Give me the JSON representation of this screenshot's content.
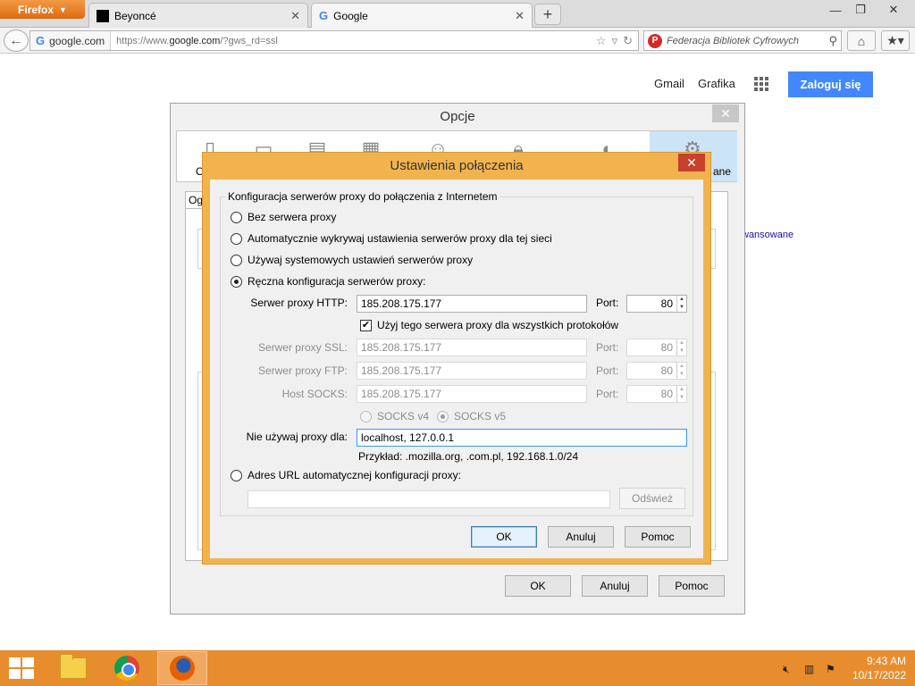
{
  "browser": {
    "menu_button": "Firefox",
    "tabs": [
      {
        "label": "Beyoncé"
      },
      {
        "label": "Google"
      }
    ],
    "identity": "google.com",
    "url_prefix": "https://www.",
    "url_domain": "google.com",
    "url_suffix": "/?gws_rd=ssl",
    "search_placeholder": "Federacja Bibliotek Cyfrowych"
  },
  "google": {
    "gmail": "Gmail",
    "images": "Grafika",
    "signin": "Zaloguj się",
    "partial_link": "wansowane"
  },
  "options_dialog": {
    "title": "Opcje",
    "partial_tab_o": "O",
    "partial_tab_ane": "ane",
    "partial_subtab": "Og",
    "ok": "OK",
    "cancel": "Anuluj",
    "help": "Pomoc"
  },
  "connection_dialog": {
    "title": "Ustawienia połączenia",
    "legend": "Konfiguracja serwerów proxy do połączenia z Internetem",
    "radio_no_proxy": "Bez serwera proxy",
    "radio_auto_detect": "Automatycznie wykrywaj ustawienia serwerów proxy dla tej sieci",
    "radio_system": "Używaj systemowych ustawień serwerów proxy",
    "radio_manual": "Ręczna konfiguracja serwerów proxy:",
    "http_label": "Serwer proxy HTTP:",
    "http_value": "185.208.175.177",
    "port_label": "Port:",
    "http_port": "80",
    "same_proxy_label": "Użyj tego serwera proxy dla wszystkich protokołów",
    "ssl_label": "Serwer proxy SSL:",
    "ssl_value": "185.208.175.177",
    "ssl_port": "80",
    "ftp_label": "Serwer proxy FTP:",
    "ftp_value": "185.208.175.177",
    "ftp_port": "80",
    "socks_label": "Host SOCKS:",
    "socks_value": "185.208.175.177",
    "socks_port": "80",
    "socks_v4": "SOCKS v4",
    "socks_v5": "SOCKS v5",
    "no_proxy_label": "Nie używaj proxy dla:",
    "no_proxy_value": "localhost, 127.0.0.1",
    "example": "Przykład: .mozilla.org, .com.pl, 192.168.1.0/24",
    "radio_pac": "Adres URL automatycznej konfiguracji proxy:",
    "pac_value": "",
    "reload": "Odśwież",
    "ok": "OK",
    "cancel": "Anuluj",
    "help": "Pomoc",
    "selected_mode": "manual",
    "same_proxy_checked": true,
    "socks_version": "v5"
  },
  "taskbar": {
    "time": "9:43 AM",
    "date": "10/17/2022"
  },
  "colors": {
    "firefox_orange": "#e66000",
    "google_blue": "#4387fd",
    "taskbar": "#e88d2e",
    "dialog_border": "#f2b34f",
    "close_red": "#c7412c"
  }
}
